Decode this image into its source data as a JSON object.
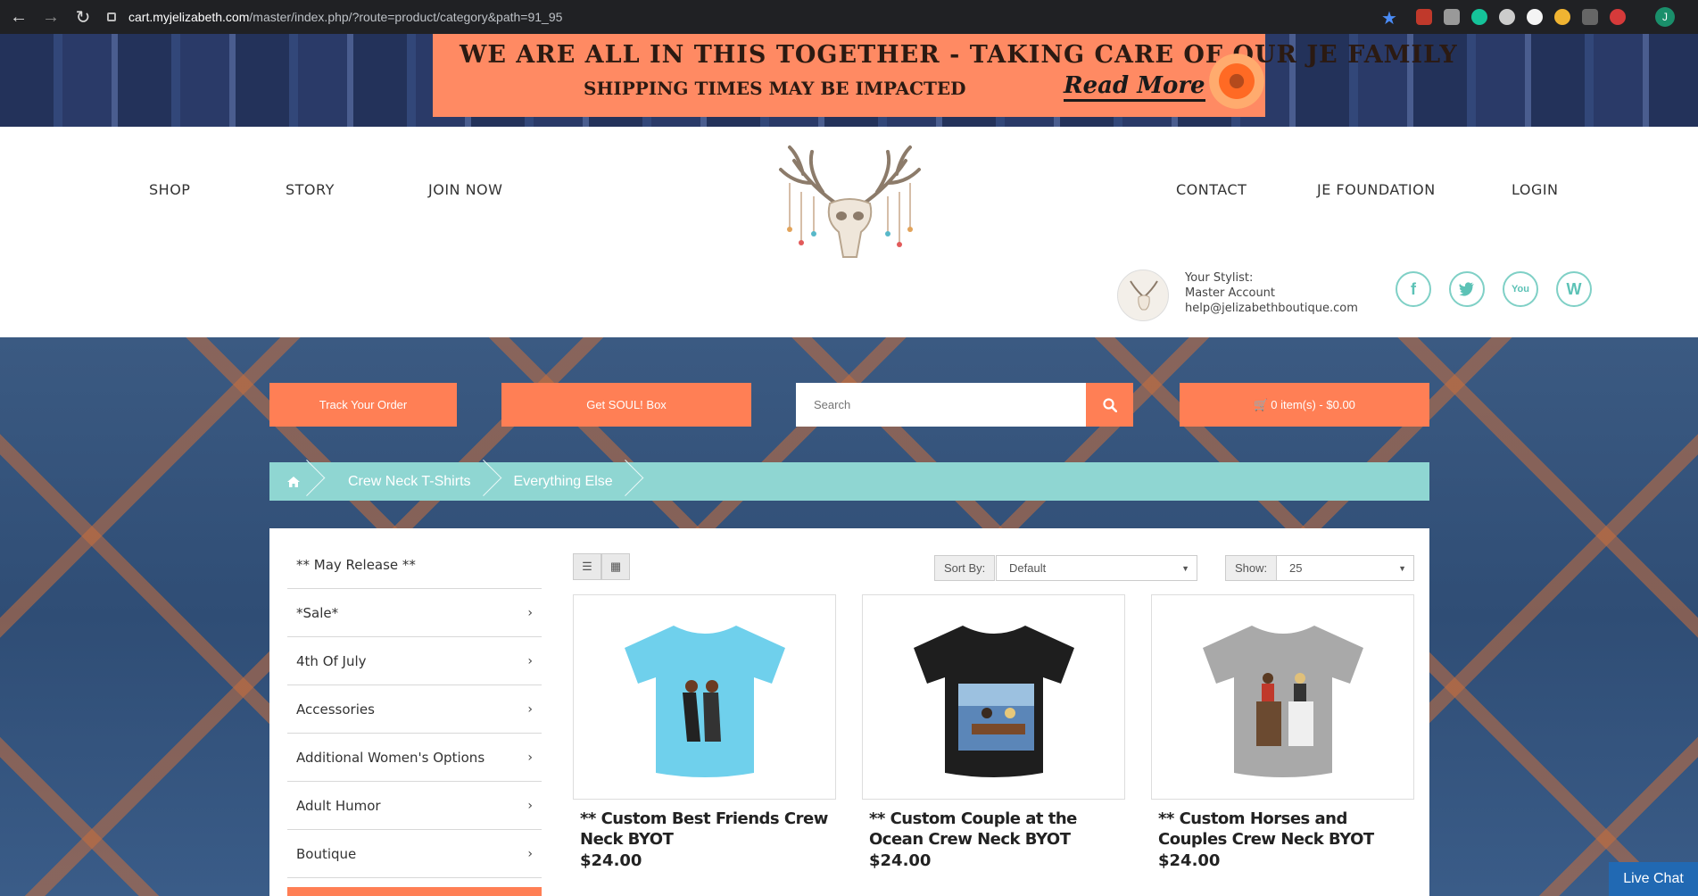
{
  "browser": {
    "url_host": "cart.myjelizabeth.com",
    "url_path": "/master/index.php/?route=product/category&path=91_95",
    "profile_initial": "J"
  },
  "banner": {
    "line1": "WE ARE ALL IN THIS TOGETHER - TAKING CARE OF OUR JE FAMILY",
    "line2": "SHIPPING TIMES MAY BE IMPACTED",
    "read_more": "Read More"
  },
  "nav": {
    "left": [
      "SHOP",
      "STORY",
      "JOIN NOW"
    ],
    "right": [
      "CONTACT",
      "JE FOUNDATION",
      "LOGIN"
    ]
  },
  "stylist": {
    "label": "Your Stylist:",
    "name": "Master Account",
    "email": "help@jelizabethboutique.com"
  },
  "social": [
    "f",
    "t",
    "You",
    "W"
  ],
  "actions": {
    "track_order": "Track Your Order",
    "soul_box": "Get SOUL! Box",
    "search_placeholder": "Search",
    "cart": "0 item(s) - $0.00"
  },
  "breadcrumb": [
    "Crew Neck T-Shirts",
    "Everything Else"
  ],
  "categories": [
    {
      "label": "** May Release **",
      "has_children": false
    },
    {
      "label": "*Sale*",
      "has_children": true
    },
    {
      "label": "4th Of July",
      "has_children": true
    },
    {
      "label": "Accessories",
      "has_children": true
    },
    {
      "label": "Additional Women's Options",
      "has_children": true
    },
    {
      "label": "Adult Humor",
      "has_children": true
    },
    {
      "label": "Boutique",
      "has_children": true
    }
  ],
  "toolbar": {
    "sort_label": "Sort By:",
    "sort_value": "Default",
    "show_label": "Show:",
    "show_value": "25"
  },
  "products": [
    {
      "name": "** Custom Best Friends Crew Neck BYOT",
      "price": "$24.00",
      "shirt_color": "#6fd0ec"
    },
    {
      "name": "** Custom Couple at the Ocean Crew Neck BYOT",
      "price": "$24.00",
      "shirt_color": "#1e1e1e"
    },
    {
      "name": "** Custom Horses and Couples Crew Neck BYOT",
      "price": "$24.00",
      "shirt_color": "#a9a9a9"
    }
  ],
  "live_chat": "Live Chat",
  "colors": {
    "accent_orange": "#ff7f55",
    "breadcrumb_teal": "#8fd6d2",
    "social_teal": "#5cc2b6",
    "live_chat_blue": "#2169b3"
  }
}
